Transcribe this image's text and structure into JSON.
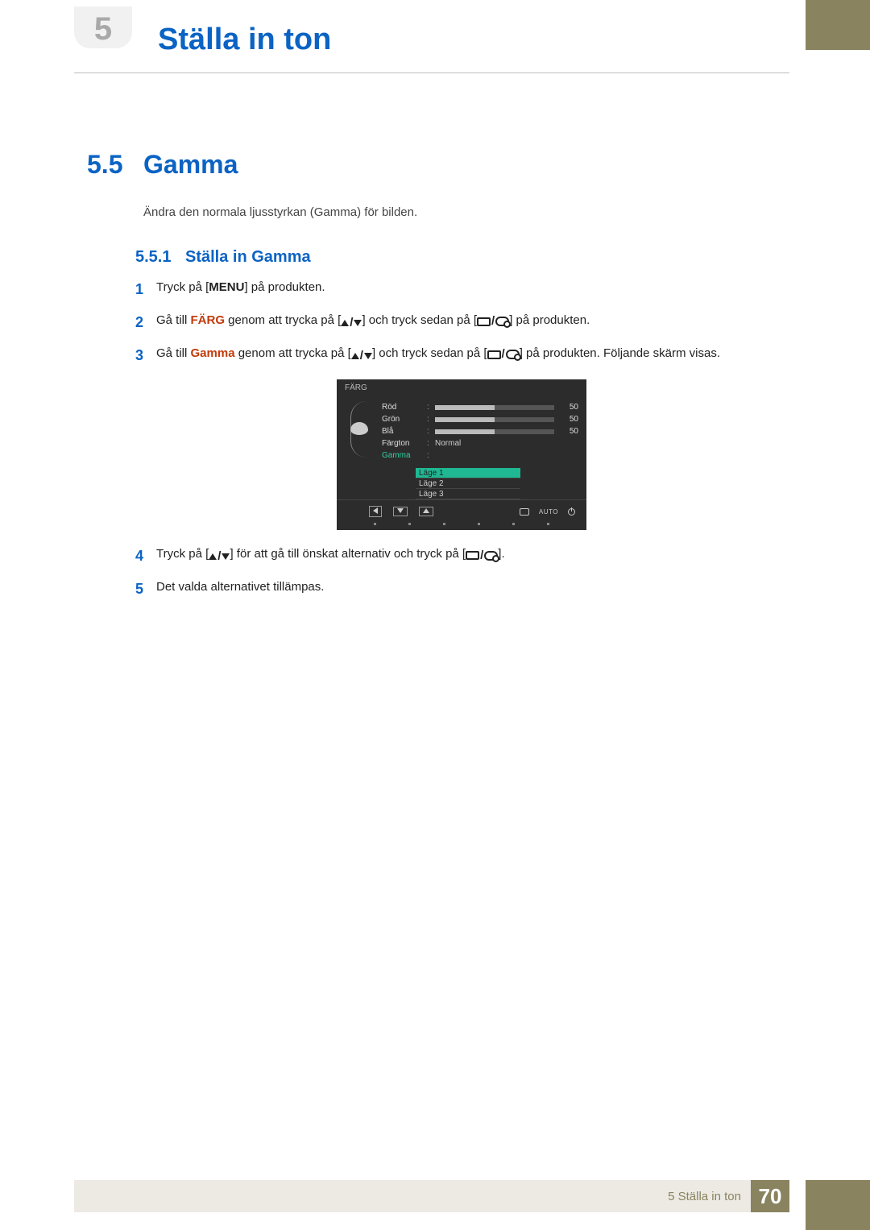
{
  "chapter_number": "5",
  "page_title": "Ställa in ton",
  "section": {
    "number": "5.5",
    "title": "Gamma",
    "intro": "Ändra den normala ljusstyrkan (Gamma) för bilden."
  },
  "subsection": {
    "number": "5.5.1",
    "title": "Ställa in Gamma"
  },
  "steps": {
    "s1": {
      "num": "1",
      "a": "Tryck på [",
      "menu": "MENU",
      "b": "] på produkten."
    },
    "s2": {
      "num": "2",
      "a": "Gå till ",
      "farg": "FÄRG",
      "b": " genom att trycka på [",
      "c": "] och tryck sedan på [",
      "d": "] på produkten."
    },
    "s3": {
      "num": "3",
      "a": "Gå till ",
      "gamma": "Gamma",
      "b": " genom att trycka på [",
      "c": "] och tryck sedan på [",
      "d": "] på produkten. Följande skärm visas."
    },
    "s4": {
      "num": "4",
      "a": "Tryck på [",
      "b": "] för att gå till önskat alternativ och tryck på [",
      "c": "]."
    },
    "s5": {
      "num": "5",
      "a": "Det valda alternativet tillämpas."
    }
  },
  "osd": {
    "title": "FÄRG",
    "rows": {
      "red": {
        "label": "Röd",
        "value": "50"
      },
      "green": {
        "label": "Grön",
        "value": "50"
      },
      "blue": {
        "label": "Blå",
        "value": "50"
      },
      "tone": {
        "label": "Färgton",
        "value": "Normal"
      },
      "gamma": {
        "label": "Gamma"
      }
    },
    "options": [
      "Läge 1",
      "Läge 2",
      "Läge 3"
    ],
    "auto": "AUTO"
  },
  "footer": {
    "chapter_ref": "5 Ställa in ton",
    "page_number": "70"
  }
}
